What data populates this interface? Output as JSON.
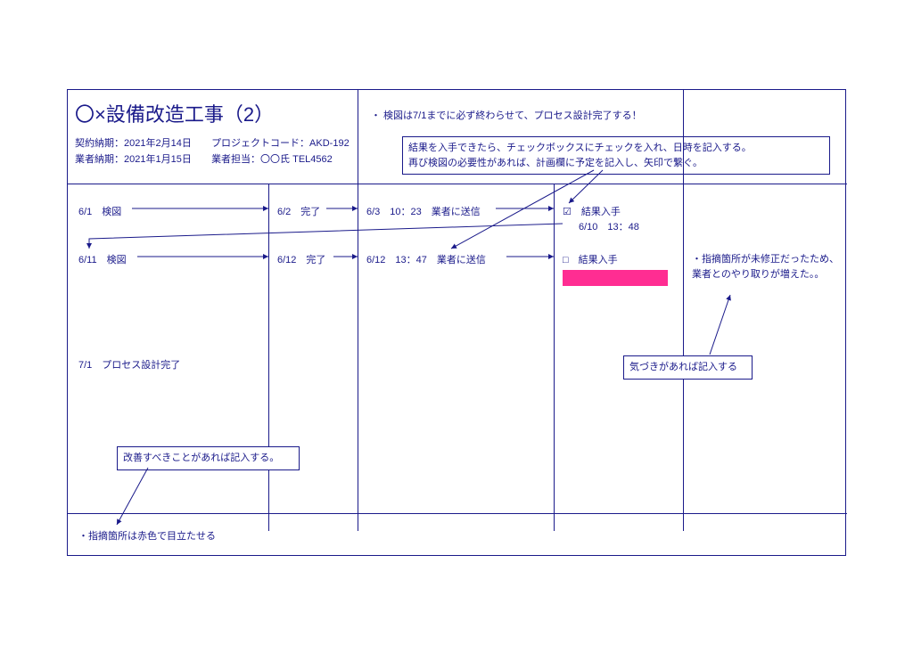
{
  "title": "〇×設備改造工事（2）",
  "meta": {
    "row1a": "契約納期：2021年2月14日",
    "row1b": "プロジェクトコード：AKD-192",
    "row2a": "業者納期：2021年1月15日",
    "row2b": "業者担当：〇〇氏 TEL4562"
  },
  "top_note": "・ 検図は7/1までに必ず終わらせて、プロセス設計完了する！",
  "callout_main_l1": "結果を入手できたら、チェックボックスにチェックを入れ、日時を記入する。",
  "callout_main_l2": "再び検図の必要性があれば、計画欄に予定を記入し、矢印で繋ぐ。",
  "row1": {
    "c1": "6/1　検図",
    "c2": "6/2　完了",
    "c3": "6/3　10：23　業者に送信",
    "c4": "☑　結果入手",
    "c4b": "6/10　13：48"
  },
  "row2": {
    "c1": "6/11　検図",
    "c2": "6/12　完了",
    "c3": "6/12　13：47　業者に送信",
    "c4": "□　結果入手"
  },
  "row3": {
    "note": "・指摘箇所が未修正だったため、業者とのやり取りが増えた。。"
  },
  "row4": {
    "c1": "7/1　プロセス設計完了"
  },
  "callout_right": "気づきがあれば記入する",
  "callout_left": "改善すべきことがあれば記入する。",
  "bottom_note": "・指摘箇所は赤色で目立たせる"
}
